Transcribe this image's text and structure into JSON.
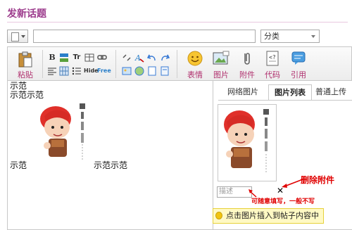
{
  "page": {
    "title": "发新话题"
  },
  "subject": {
    "value": "",
    "placeholder": ""
  },
  "category": {
    "selected": "分类"
  },
  "toolbar": {
    "paste_label": "粘贴",
    "bold": "B",
    "text_tr": "Tr",
    "hide": "Hide",
    "free": "Free",
    "emoticon_label": "表情",
    "image_label": "图片",
    "attachment_label": "附件",
    "code_label": "代码",
    "quote_label": "引用"
  },
  "content": {
    "lines": [
      "示范",
      "示范示范",
      "示范",
      "示范示范"
    ]
  },
  "panel": {
    "tabs": [
      "网络图片",
      "图片列表",
      "普通上传"
    ],
    "active_tab": "图片列表",
    "desc_placeholder": "描述",
    "delete_mark": "✕",
    "insert_hint": "点击图片插入到帖子内容中"
  },
  "annotations": {
    "delete": "删除附件",
    "hint": "可随意填写，一般不写"
  },
  "colors": {
    "title": "#9c3b8c",
    "annotation": "#e00000",
    "tab_border": "#c8c8c8"
  }
}
